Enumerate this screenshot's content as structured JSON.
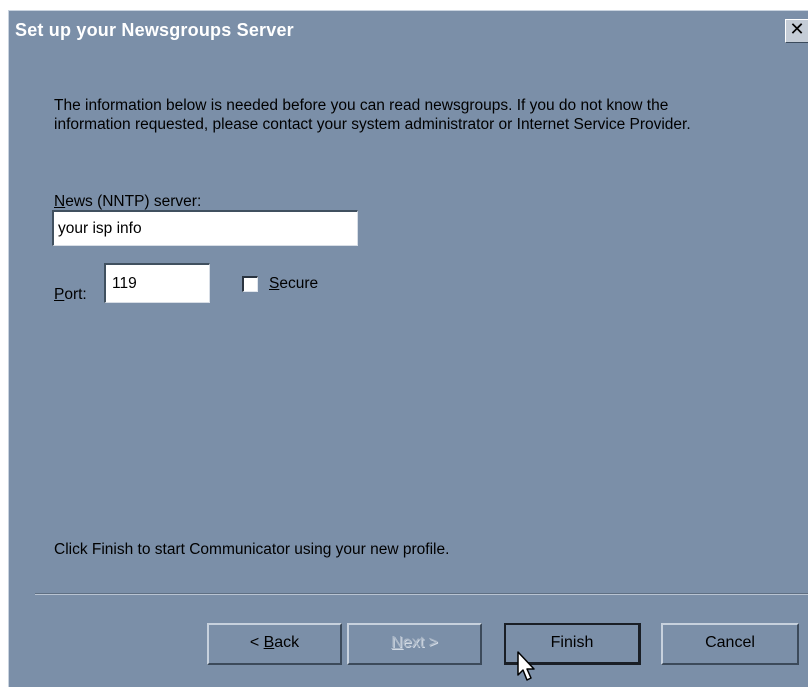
{
  "window": {
    "title": "Set up your Newsgroups Server",
    "close_glyph": "✕"
  },
  "intro_text": "The information below is needed before you can read newsgroups.  If you do not know the information requested, please contact your system administrator or Internet Service Provider.",
  "server": {
    "label_first": "N",
    "label_rest": "ews (NNTP) server:",
    "value": "your isp info"
  },
  "port": {
    "label_first": "P",
    "label_rest": "ort:",
    "value": "119"
  },
  "secure": {
    "label_first": "S",
    "label_rest": "ecure",
    "checked": false
  },
  "finish_hint": "Click Finish to start Communicator using your new profile.",
  "buttons": {
    "back_prefix": "< ",
    "back_first": "B",
    "back_rest": "ack",
    "next_first": "N",
    "next_rest": "ext >",
    "finish": "Finish",
    "cancel": "Cancel"
  },
  "icons": {
    "close": "close-icon",
    "pointer": "mouse-pointer-icon"
  }
}
